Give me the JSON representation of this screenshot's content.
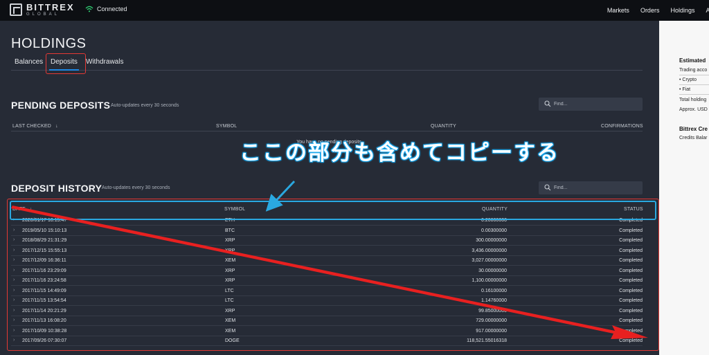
{
  "header": {
    "logo_main": "BITTREX",
    "logo_sub": "GLOBAL",
    "connection_status": "Connected",
    "nav": [
      "Markets",
      "Orders",
      "Holdings",
      "Ac"
    ]
  },
  "page": {
    "title": "HOLDINGS",
    "tabs": [
      {
        "label": "Balances",
        "active": false
      },
      {
        "label": "Deposits",
        "active": true
      },
      {
        "label": "Withdrawals",
        "active": false
      }
    ]
  },
  "pending": {
    "title": "PENDING DEPOSITS",
    "subtitle": "Auto-updates every 30 seconds",
    "search_placeholder": "Find...",
    "columns": {
      "last_checked": "LAST CHECKED",
      "symbol": "SYMBOL",
      "quantity": "QUANTITY",
      "confirmations": "CONFIRMATIONS"
    },
    "empty_message": "You have no pending deposits."
  },
  "history": {
    "title": "DEPOSIT HISTORY",
    "subtitle": "Auto-updates every 30 seconds",
    "search_placeholder": "Find...",
    "columns": {
      "date": "DATE",
      "symbol": "SYMBOL",
      "quantity": "QUANTITY",
      "status": "STATUS"
    },
    "rows": [
      {
        "date": "2020/01/17 10:15:47",
        "symbol": "ETH",
        "quantity": "0.20000000",
        "status": "Completed"
      },
      {
        "date": "2019/05/10 15:10:13",
        "symbol": "BTC",
        "quantity": "0.00300000",
        "status": "Completed"
      },
      {
        "date": "2018/08/29 21:31:29",
        "symbol": "XRP",
        "quantity": "300.00000000",
        "status": "Completed"
      },
      {
        "date": "2017/12/15 15:55:13",
        "symbol": "XRP",
        "quantity": "3,436.00000000",
        "status": "Completed"
      },
      {
        "date": "2017/12/09 16:36:11",
        "symbol": "XEM",
        "quantity": "3,027.00000000",
        "status": "Completed"
      },
      {
        "date": "2017/11/16 23:29:09",
        "symbol": "XRP",
        "quantity": "30.00000000",
        "status": "Completed"
      },
      {
        "date": "2017/11/16 23:24:58",
        "symbol": "XRP",
        "quantity": "1,100.00000000",
        "status": "Completed"
      },
      {
        "date": "2017/11/15 14:49:09",
        "symbol": "LTC",
        "quantity": "0.16100000",
        "status": "Completed"
      },
      {
        "date": "2017/11/15 13:54:54",
        "symbol": "LTC",
        "quantity": "1.14760000",
        "status": "Completed"
      },
      {
        "date": "2017/11/14 20:21:29",
        "symbol": "XRP",
        "quantity": "99.85000000",
        "status": "Completed"
      },
      {
        "date": "2017/11/13 16:08:20",
        "symbol": "XEM",
        "quantity": "729.00000000",
        "status": "Completed"
      },
      {
        "date": "2017/10/09 10:38:28",
        "symbol": "XEM",
        "quantity": "917.00000000",
        "status": "Completed"
      },
      {
        "date": "2017/09/26 07:30:07",
        "symbol": "DOGE",
        "quantity": "118,521.55016318",
        "status": "Completed"
      }
    ]
  },
  "annotation": {
    "text": "ここの部分も含めてコピーする"
  },
  "right_panel": {
    "estimated_heading": "Estimated",
    "trading_account": "Trading acco",
    "crypto": "• Crypto",
    "fiat": "• Fiat",
    "total_holdings": "Total holding",
    "approx_usd": "Approx. USD",
    "credits_heading": "Bittrex Cre",
    "credits_balance": "Credits Balar"
  },
  "colors": {
    "accent": "#1e88e5",
    "annotation_red": "#e53935",
    "annotation_blue": "#2aa8e0",
    "connected_green": "#2ecc71"
  }
}
